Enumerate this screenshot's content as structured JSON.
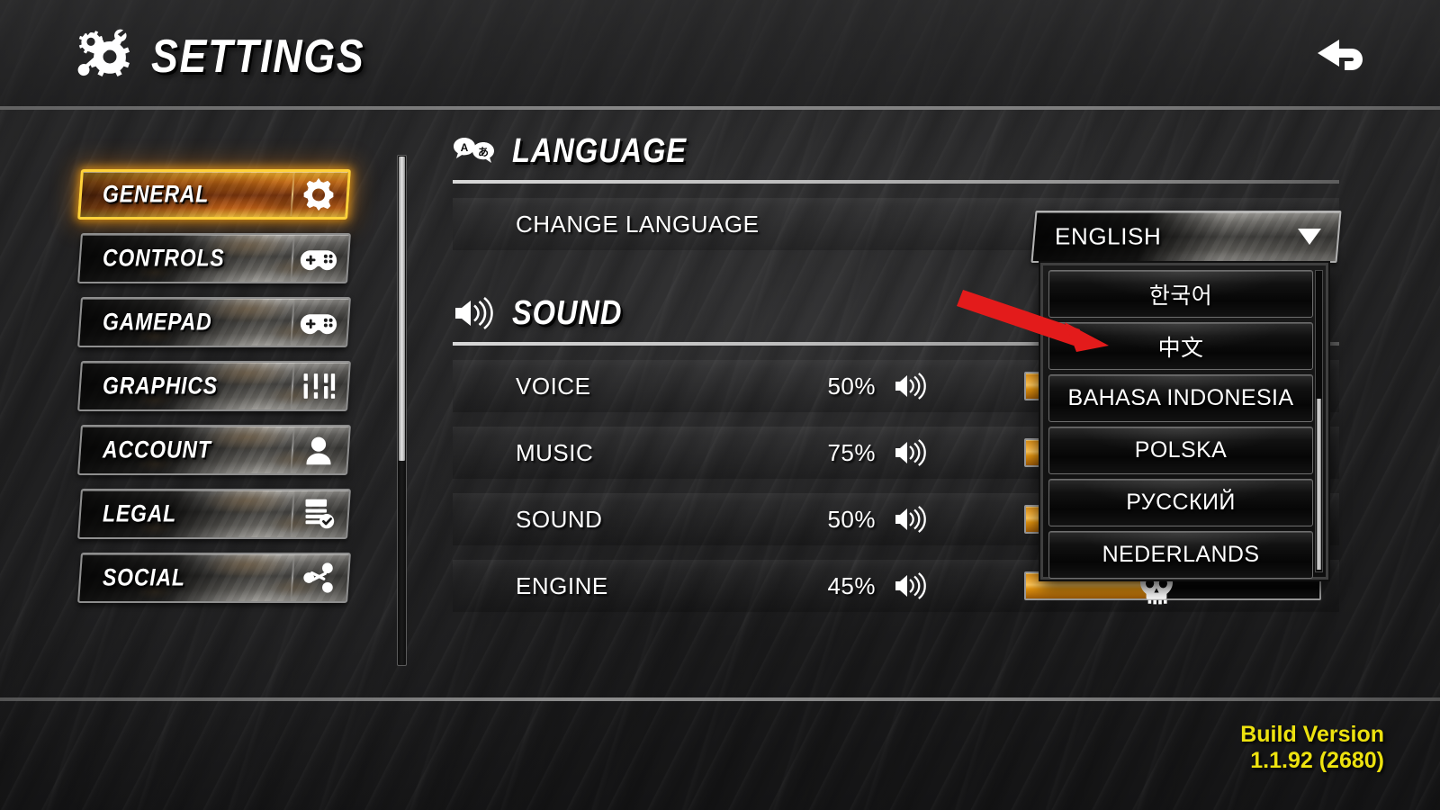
{
  "header": {
    "title": "SETTINGS",
    "title_icon": "gear-wrench-icon",
    "back_icon": "back-arrow-icon"
  },
  "sidebar": {
    "items": [
      {
        "label": "GENERAL",
        "icon": "gear-icon",
        "active": true
      },
      {
        "label": "CONTROLS",
        "icon": "gamepad-icon",
        "active": false
      },
      {
        "label": "GAMEPAD",
        "icon": "gamepad-icon",
        "active": false
      },
      {
        "label": "GRAPHICS",
        "icon": "sliders-icon",
        "active": false
      },
      {
        "label": "ACCOUNT",
        "icon": "person-icon",
        "active": false
      },
      {
        "label": "LEGAL",
        "icon": "document-check-icon",
        "active": false
      },
      {
        "label": "SOCIAL",
        "icon": "share-icon",
        "active": false
      }
    ]
  },
  "language_section": {
    "title": "LANGUAGE",
    "icon": "translate-icon",
    "row_label": "CHANGE LANGUAGE",
    "selected_value": "ENGLISH",
    "chevron_icon": "chevron-down-icon",
    "options": [
      "한국어",
      "中文",
      "BAHASA INDONESIA",
      "POLSKA",
      "РУССКИЙ",
      "NEDERLANDS"
    ],
    "highlighted_option": "中文"
  },
  "sound_section": {
    "title": "SOUND",
    "icon": "speaker-icon",
    "rows": [
      {
        "label": "VOICE",
        "percent": "50%",
        "value": 50,
        "speaker_icon": "speaker-icon",
        "handle_icon": "skull-handle-icon"
      },
      {
        "label": "MUSIC",
        "percent": "75%",
        "value": 75,
        "speaker_icon": "speaker-icon",
        "handle_icon": "skull-handle-icon"
      },
      {
        "label": "SOUND",
        "percent": "50%",
        "value": 50,
        "speaker_icon": "speaker-icon",
        "handle_icon": "skull-handle-icon"
      },
      {
        "label": "ENGINE",
        "percent": "45%",
        "value": 45,
        "speaker_icon": "speaker-icon",
        "handle_icon": "skull-handle-icon"
      }
    ]
  },
  "annotation": {
    "type": "arrow",
    "color": "#e31b1b",
    "points_to": "中文"
  },
  "footer": {
    "build_label": "Build Version",
    "build_value": "1.1.92 (2680)",
    "color": "#ede20f"
  },
  "colors": {
    "accent_orange": "#f5a623",
    "active_border": "#ffd23a",
    "yellow_text": "#ede20f",
    "arrow_red": "#e31b1b",
    "panel_dark": "#0e0e0e"
  }
}
